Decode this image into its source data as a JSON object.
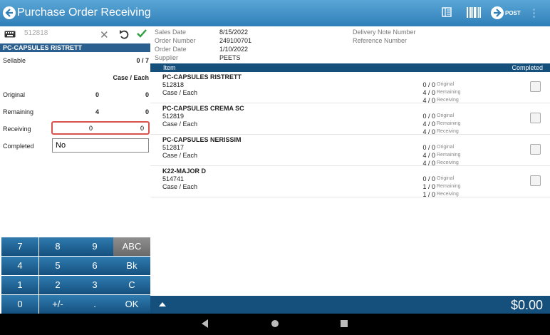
{
  "app": {
    "title": "Purchase Order Receiving",
    "post_label": "POST"
  },
  "search": {
    "value": "512818"
  },
  "selected_item": {
    "name": "PC-CAPSULES RISTRETT",
    "sellable_label": "Sellable",
    "sellable_value": "0 / 7",
    "uom_header": "Case / Each",
    "original_label": "Original",
    "original_case": "0",
    "original_each": "0",
    "remaining_label": "Remaining",
    "remaining_case": "4",
    "remaining_each": "0",
    "receiving_label": "Receiving",
    "receiving_case": "0",
    "receiving_each": "0",
    "completed_label": "Completed",
    "completed_value": "No"
  },
  "keypad": {
    "keys": [
      "7",
      "8",
      "9",
      "ABC",
      "4",
      "5",
      "6",
      "Bk",
      "1",
      "2",
      "3",
      "C",
      "0",
      "+/-",
      ".",
      "OK"
    ]
  },
  "order": {
    "sales_date_label": "Sales Date",
    "sales_date": "8/15/2022",
    "order_number_label": "Order Number",
    "order_number": "249100701",
    "order_date_label": "Order Date",
    "order_date": "1/10/2022",
    "supplier_label": "Supplier",
    "supplier": "PEETS",
    "delivery_note_label": "Delivery Note Number",
    "reference_label": "Reference Number"
  },
  "table": {
    "col_item": "Item",
    "col_completed": "Completed",
    "qty_labels": [
      "Original",
      "Remaining",
      "Receiving"
    ],
    "rows": [
      {
        "name": "PC-CAPSULES RISTRETT",
        "code": "512818",
        "uom": "Case / Each",
        "original": "0 / 0",
        "remaining": "4 / 0",
        "receiving": "4 / 0"
      },
      {
        "name": "PC-CAPSULES CREMA SC",
        "code": "512819",
        "uom": "Case / Each",
        "original": "0 / 0",
        "remaining": "4 / 0",
        "receiving": "4 / 0"
      },
      {
        "name": "PC-CAPSULES NERISSIM",
        "code": "512817",
        "uom": "Case / Each",
        "original": "0 / 0",
        "remaining": "4 / 0",
        "receiving": "4 / 0"
      },
      {
        "name": "K22-MAJOR D",
        "code": "514741",
        "uom": "Case / Each",
        "original": "0 / 0",
        "remaining": "1 / 0",
        "receiving": "1 / 0"
      }
    ]
  },
  "footer": {
    "total": "$0.00"
  },
  "colors": {
    "title_bar": "#2f7fb8",
    "header_dark": "#154f7c",
    "key_blue": "#2f7bb0",
    "highlight_red": "#d9534f",
    "check_green": "#2e9e3e"
  }
}
